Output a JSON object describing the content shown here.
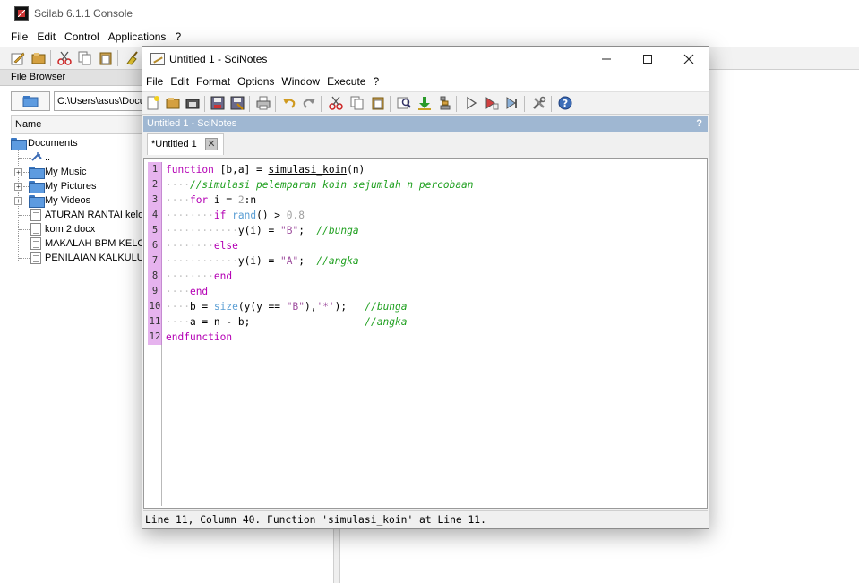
{
  "console": {
    "title": "Scilab 6.1.1 Console",
    "menu": [
      "File",
      "Edit",
      "Control",
      "Applications",
      "?"
    ],
    "file_browser": {
      "header": "File Browser",
      "path": "C:\\Users\\asus\\Documents",
      "column_name": "Name",
      "tree": [
        {
          "label": "Documents",
          "type": "folder"
        },
        {
          "label": "..",
          "type": "up"
        },
        {
          "label": "My Music",
          "type": "folder"
        },
        {
          "label": "My Pictures",
          "type": "folder"
        },
        {
          "label": "My Videos",
          "type": "folder"
        },
        {
          "label": "ATURAN RANTAI kelompok",
          "type": "file"
        },
        {
          "label": "kom 2.docx",
          "type": "file"
        },
        {
          "label": "MAKALAH BPM KELOMPOK",
          "type": "file"
        },
        {
          "label": "PENILAIAN KALKULUS",
          "type": "file"
        }
      ]
    }
  },
  "scinotes": {
    "title": "Untitled 1 - SciNotes",
    "menu": [
      "File",
      "Edit",
      "Format",
      "Options",
      "Window",
      "Execute",
      "?"
    ],
    "doc_header": "Untitled 1 - SciNotes",
    "doc_header_help": "?",
    "tab_label": "*Untitled 1",
    "code_lines": [
      "function [b,a] = simulasi_koin(n)",
      "    //simulasi pelemparan koin sejumlah n percobaan",
      "    for i = 2:n",
      "        if rand() > 0.8",
      "            y(i) = \"B\";  //bunga",
      "        else",
      "            y(i) = \"A\";  //angka",
      "        end",
      "    end",
      "    b = size(y(y == \"B\"),'*');   //bunga",
      "    a = n - b;                   //angka",
      "endfunction"
    ],
    "line_numbers": [
      "1",
      "2",
      "3",
      "4",
      "5",
      "6",
      "7",
      "8",
      "9",
      "10",
      "11",
      "12"
    ],
    "status": "Line 11, Column 40. Function 'simulasi_koin' at Line 11."
  },
  "colors": {
    "keyword": "#b400b4",
    "builtin": "#5a9ed4",
    "comment": "#20a020",
    "string": "#9e4e9e",
    "gutter": "#e6b3ee",
    "doc_header": "#9fb7d2"
  }
}
